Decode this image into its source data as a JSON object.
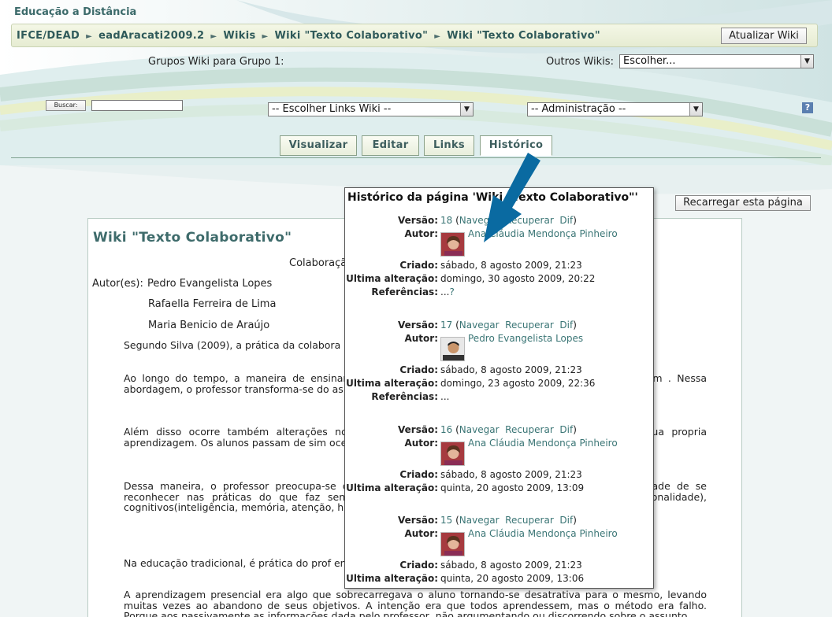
{
  "site_title": "Educação a Distância",
  "breadcrumb": {
    "items": [
      "IFCE/DEAD",
      "eadAracati2009.2",
      "Wikis",
      "Wiki \"Texto Colaborativo\"",
      "Wiki \"Texto Colaborativo\""
    ],
    "separator": "►"
  },
  "update_wiki_button": "Atualizar Wiki",
  "groups_label": "Grupos Wiki para Grupo 1:",
  "other_wikis": {
    "label": "Outros Wikis:",
    "value": "Escolher..."
  },
  "search": {
    "button": "Buscar:",
    "value": ""
  },
  "links_select": "-- Escolher Links Wiki --",
  "admin_select": "-- Administração --",
  "help_icon": "?",
  "tabs": [
    "Visualizar",
    "Editar",
    "Links",
    "Histórico"
  ],
  "reload_button": "Recarregar esta página",
  "content": {
    "title": "Wiki \"Texto Colaborativo\"",
    "subtitle": "Colaboraçã",
    "authors_label": "Autor(es):",
    "authors": [
      "Pedro Evangelista Lopes",
      "Rafaella Ferreira de Lima",
      "Maria Benicio de Araújo"
    ],
    "paragraphs": [
      "Segundo Silva (2009), a prática da colabora r meio do que é possível aprender com o outro através",
      "Ao longo do tempo, a maneira de ensinar e dar aulas\", passar ou transmitir conhecimento para com . Nessa abordagem, o professor transforma-se do as tarefas postas em ação, estimulador, (co) participan",
      "Além disso ocorre também alterações no dado ao professor é descentralizado de maneira que ua propria aprendizagem. Os alunos passam de sim ocesso de apredizagem e assumem atitudes mais crític ado.",
      "Dessa maneira, o professor preocupa-se ocesso de formação. Isso implica uma menor ênfase bilidade de se reconhecer nas práticas do que faz senti contexto, passa a combinar objetivos sociais (intera onalidade), cognitivos(inteligência, memória, atenção, horizontes teóricos.",
      "Na educação tradicional, é prática do prof entrada no conteúdo, deixando muitas vezes de trabalh",
      "A aprendizagem presencial era algo que sobrecarregava o aluno tornando-se desatrativa para o mesmo, levando muitas vezes ao abandono de seus objetivos. A intenção era que todos aprendessem, mas o método era falho. Porque aos passivamente as informações dada pelo professor, não argumentando ou discorrendo sobre o assunto."
    ]
  },
  "history_popup": {
    "title": "Histórico da página 'Wiki \"Texto Colaborativo\"'",
    "labels": {
      "version": "Versão:",
      "author": "Autor:",
      "created": "Criado:",
      "modified": "Ultima alteração:",
      "refs": "Referências:"
    },
    "actions": [
      "Navegar",
      "Recuperar",
      "Dif"
    ],
    "versions": [
      {
        "num": "18",
        "author": "Ana Cláudia Mendonça Pinheiro",
        "avatar": "female-avatar",
        "created": "sábado, 8 agosto 2009, 21:23",
        "modified": "domingo, 30 agosto 2009, 20:22",
        "refs": "...",
        "refs_link": "?"
      },
      {
        "num": "17",
        "author": "Pedro Evangelista Lopes",
        "avatar": "male-avatar",
        "created": "sábado, 8 agosto 2009, 21:23",
        "modified": "domingo, 23 agosto 2009, 22:36",
        "refs": "...",
        "refs_link": ""
      },
      {
        "num": "16",
        "author": "Ana Cláudia Mendonça Pinheiro",
        "avatar": "female-avatar",
        "created": "sábado, 8 agosto 2009, 21:23",
        "modified": "quinta, 20 agosto 2009, 13:09"
      },
      {
        "num": "15",
        "author": "Ana Cláudia Mendonça Pinheiro",
        "avatar": "female-avatar",
        "created": "sábado, 8 agosto 2009, 21:23",
        "modified": "quinta, 20 agosto 2009, 13:06"
      }
    ]
  },
  "annotation_arrow": "pointer-arrow-icon",
  "colors": {
    "accent": "#3e6b6b",
    "arrow": "#0a6aa1",
    "link": "#3a7575"
  }
}
